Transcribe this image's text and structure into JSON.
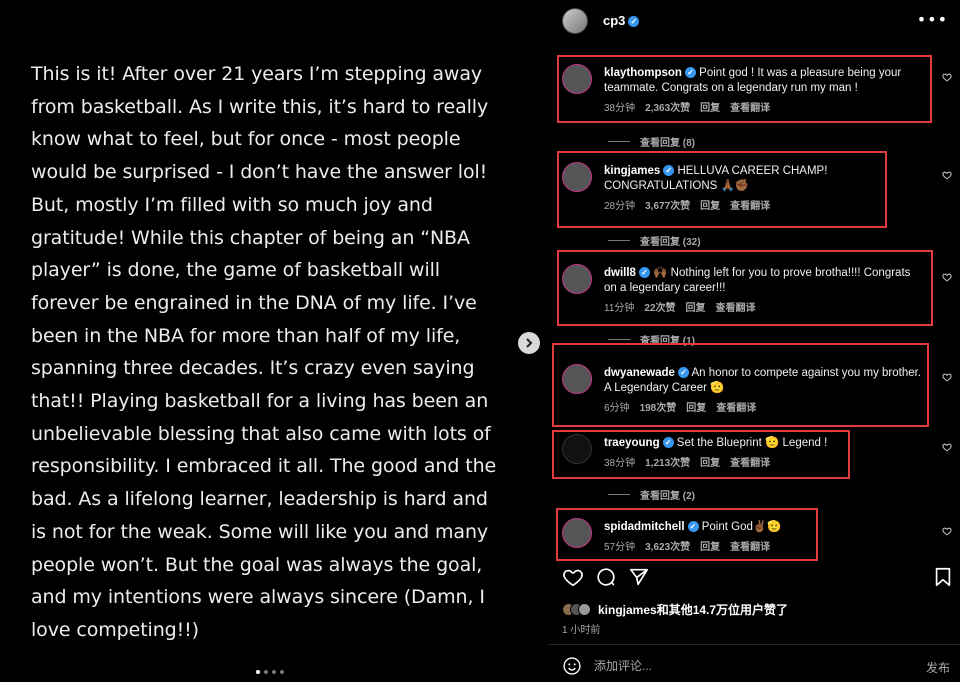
{
  "post_image": {
    "lines": [
      "This is it! After over 21 years I’m stepping away",
      "from basketball.  As I write this, it’s hard to really",
      "know what to feel, but for once - most people",
      "would be surprised - I don’t have the answer lol!",
      "But, mostly I’m filled with so much  joy and",
      "gratitude! While this chapter of being an “NBA",
      "player” is done, the game of basketball will",
      "forever be engrained in the DNA of my life. I’ve",
      "been in the NBA for more than half of my life,",
      "spanning three decades. It’s crazy even saying",
      "that!! Playing basketball for a living has been an",
      "unbelievable blessing that also came with lots of",
      "responsibility.  I embraced it all. The good and the",
      "bad. As a lifelong learner, leadership is hard and",
      "is not for the weak. Some will like you and many",
      "people won’t. But the goal was always the goal,",
      "and my intentions were always sincere (Damn, I",
      "love competing!!)"
    ],
    "next_icon": "chevron-right-icon",
    "carousel_total": 4,
    "carousel_active": 1
  },
  "header": {
    "username": "cp3",
    "verified_icon": "verified-badge-icon",
    "more_icon": "more-horizontal-icon",
    "more_glyph": "•••"
  },
  "comments": [
    {
      "user": "klaythompson",
      "verified": true,
      "text": "Point god ! It was a pleasure being your teammate. Congrats on a legendary run my man !",
      "time": "38分钟",
      "likes": "2,363次赞",
      "reply": "回复",
      "translate": "查看翻译",
      "replies": "查看回复 (8)"
    },
    {
      "user": "kingjames",
      "verified": true,
      "text": "HELLUVA CAREER CHAMP! CONGRATULATIONS 🙏🏾✊🏾",
      "time": "28分钟",
      "likes": "3,677次赞",
      "reply": "回复",
      "translate": "查看翻译",
      "replies": "查看回复 (32)"
    },
    {
      "user": "dwill8",
      "verified": true,
      "text": "🙌🏾 Nothing left for you to prove brotha!!!! Congrats on a legendary career!!!",
      "time": "11分钟",
      "likes": "22次赞",
      "reply": "回复",
      "translate": "查看翻译",
      "replies": "查看回复 (1)"
    },
    {
      "user": "dwyanewade",
      "verified": true,
      "text": "An honor to compete against you my brother. A Legendary Career 🫡",
      "time": "6分钟",
      "likes": "198次赞",
      "reply": "回复",
      "translate": "查看翻译",
      "replies": ""
    },
    {
      "user": "traeyoung",
      "verified": true,
      "text": "Set the Blueprint 🫡 Legend !",
      "time": "38分钟",
      "likes": "1,213次赞",
      "reply": "回复",
      "translate": "查看翻译",
      "replies": "查看回复 (2)"
    },
    {
      "user": "spidadmitchell",
      "verified": true,
      "text": "Point God✌🏾🫡",
      "time": "57分钟",
      "likes": "3,623次赞",
      "reply": "回复",
      "translate": "查看翻译",
      "replies": ""
    }
  ],
  "actions": {
    "like_icon": "heart-icon",
    "comment_icon": "comment-bubble-icon",
    "share_icon": "send-icon",
    "save_icon": "bookmark-icon"
  },
  "likes_summary": "kingjames和其他14.7万位用户赞了",
  "time_ago": "1 小时前",
  "comment_box": {
    "emoji_icon": "smiley-icon",
    "placeholder": "添加评论...",
    "post_label": "发布"
  },
  "colors": {
    "verified": "#3797f0",
    "highlight_box": "#e23b3b",
    "meta_text": "#a8a8a8"
  }
}
